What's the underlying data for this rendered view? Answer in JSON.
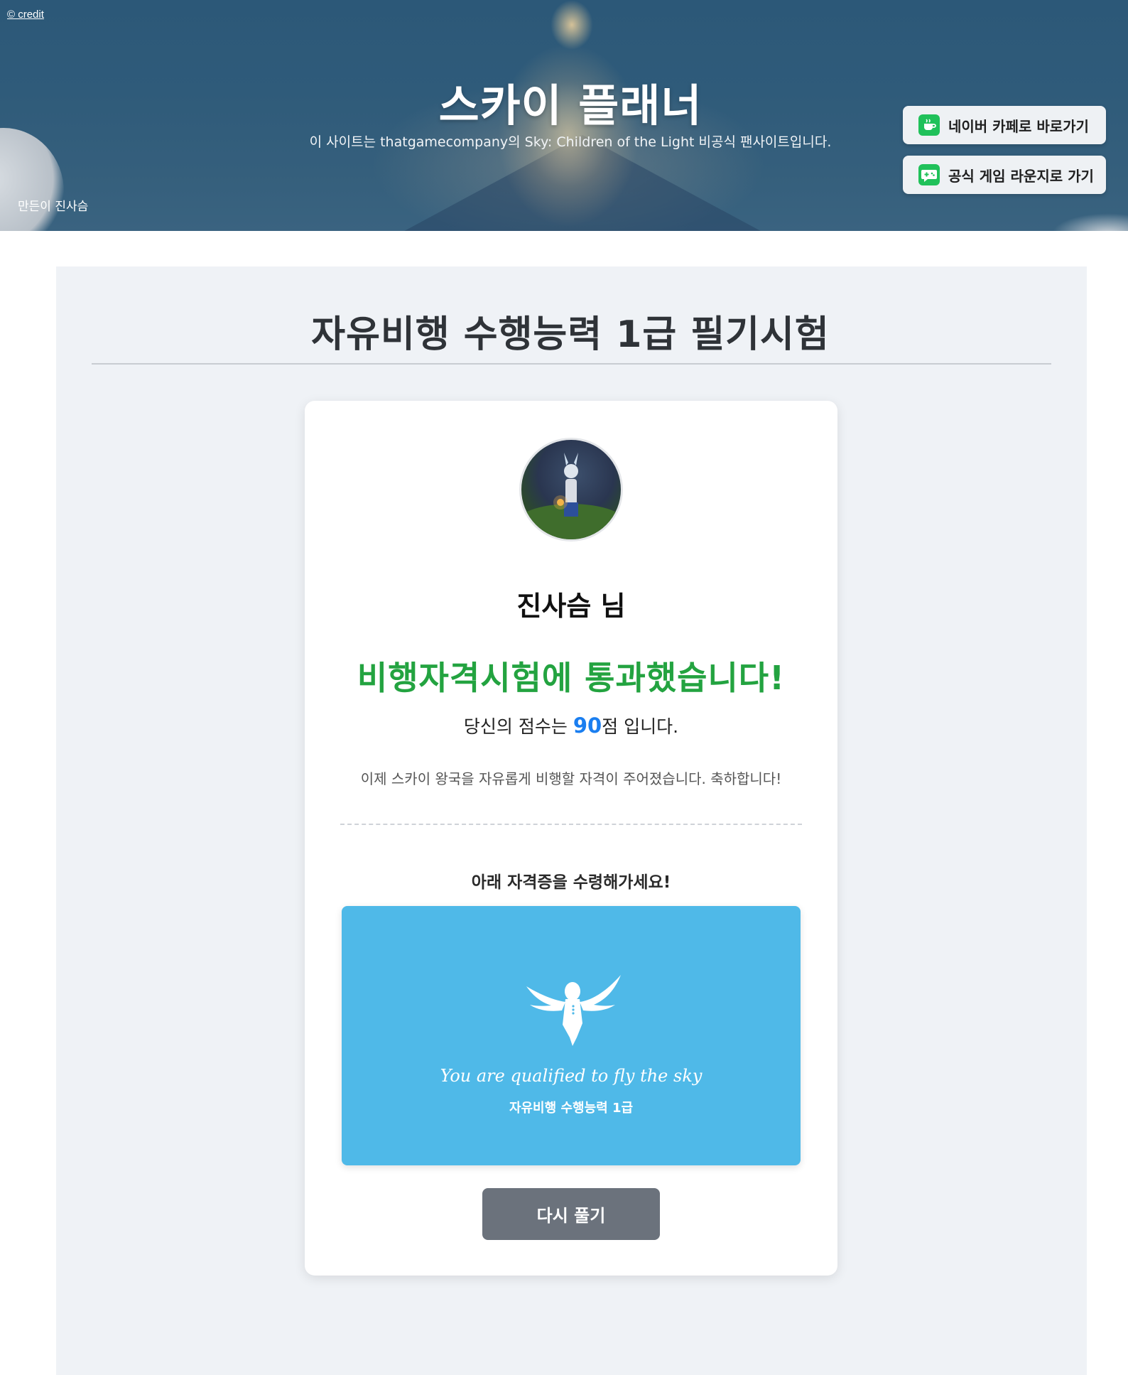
{
  "header": {
    "credit_link": "© credit",
    "site_title": "스카이 플래너",
    "subtitle": "이 사이트는 thatgamecompany의 Sky: Children of the Light 비공식 팬사이트입니다.",
    "made_by": "만든이 진사슴",
    "buttons": [
      {
        "label": "네이버 카페로 바로가기",
        "icon": "naver-cafe-icon"
      },
      {
        "label": "공식 게임 라운지로 가기",
        "icon": "game-lounge-icon"
      }
    ]
  },
  "exam": {
    "title": "자유비행 수행능력 1급 필기시험"
  },
  "result": {
    "avatar": "player-avatar-image",
    "user_name": "진사슴 님",
    "pass_message": "비행자격시험에 통과했습니다!",
    "score_prefix": "당신의 점수는 ",
    "score_value": "90",
    "score_suffix": "점 입니다.",
    "congrats": "이제 스카이 왕국을 자유롭게 비행할 자격이 주어졌습니다. 축하합니다!",
    "cert_prompt": "아래 자격증을 수령해가세요!"
  },
  "certificate": {
    "emblem": "winged-child-icon",
    "tagline": "You are qualified to fly the sky",
    "grade": "자유비행 수행능력 1급",
    "background_color": "#4fb9e8"
  },
  "actions": {
    "retry_label": "다시 풀기"
  },
  "colors": {
    "pass_green": "#23a340",
    "score_blue": "#1a7ef0",
    "retry_gray": "#6b727c"
  }
}
